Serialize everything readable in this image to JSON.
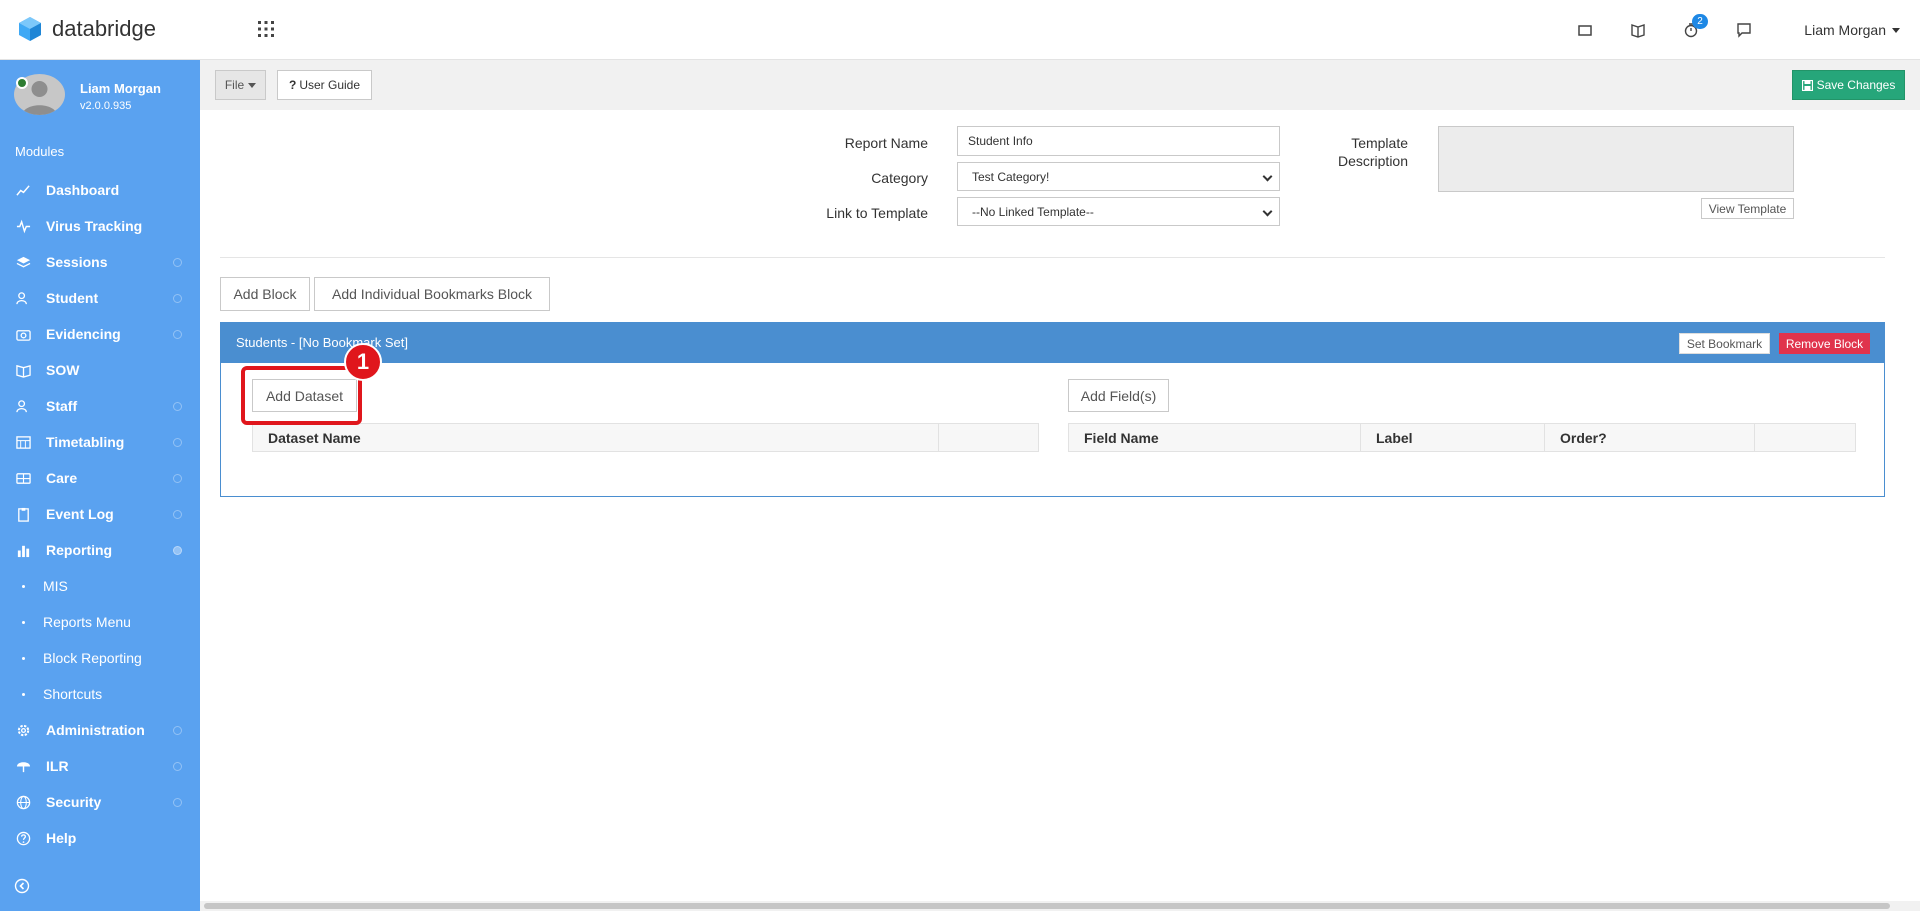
{
  "topbar": {
    "brand": "databridge",
    "notification_count": "2",
    "user_name": "Liam Morgan"
  },
  "sidebar": {
    "user_name": "Liam Morgan",
    "version": "v2.0.0.935",
    "modules_label": "Modules",
    "items": [
      {
        "label": "Dashboard",
        "icon": "chart-line-icon"
      },
      {
        "label": "Virus Tracking",
        "icon": "pulse-icon"
      },
      {
        "label": "Sessions",
        "icon": "layers-icon"
      },
      {
        "label": "Student",
        "icon": "users-icon"
      },
      {
        "label": "Evidencing",
        "icon": "camera-icon"
      },
      {
        "label": "SOW",
        "icon": "book-icon"
      },
      {
        "label": "Staff",
        "icon": "users-icon"
      },
      {
        "label": "Timetabling",
        "icon": "calendar-icon"
      },
      {
        "label": "Care",
        "icon": "id-card-icon"
      },
      {
        "label": "Event Log",
        "icon": "clipboard-icon"
      },
      {
        "label": "Reporting",
        "icon": "bar-chart-icon"
      }
    ],
    "sub_items": [
      "MIS",
      "Reports Menu",
      "Block Reporting",
      "Shortcuts"
    ],
    "bottom_items": [
      {
        "label": "Administration",
        "icon": "gear-icon"
      },
      {
        "label": "ILR",
        "icon": "umbrella-icon"
      },
      {
        "label": "Security",
        "icon": "globe-icon"
      },
      {
        "label": "Help",
        "icon": "help-circle-icon"
      }
    ]
  },
  "toolbar": {
    "file_label": "File",
    "guide_label": "User Guide",
    "save_label": "Save Changes"
  },
  "form": {
    "report_name_label": "Report Name",
    "report_name_value": "Student Info",
    "category_label": "Category",
    "category_value": "Test Category!",
    "link_label": "Link to Template",
    "link_value": "--No Linked Template--",
    "template_desc_label_1": "Template",
    "template_desc_label_2": "Description",
    "view_template_label": "View Template"
  },
  "actions": {
    "add_block": "Add Block",
    "add_bookmarks_block": "Add Individual Bookmarks Block"
  },
  "block": {
    "title": "Students - [No Bookmark Set]",
    "set_bookmark": "Set Bookmark",
    "remove_block": "Remove Block",
    "add_dataset": "Add Dataset",
    "add_fields": "Add Field(s)",
    "dataset_headers": [
      "Dataset Name",
      ""
    ],
    "field_headers": [
      "Field Name",
      "Label",
      "Order?",
      ""
    ]
  },
  "annotation": {
    "step": "1",
    "color": "#e0161c"
  }
}
